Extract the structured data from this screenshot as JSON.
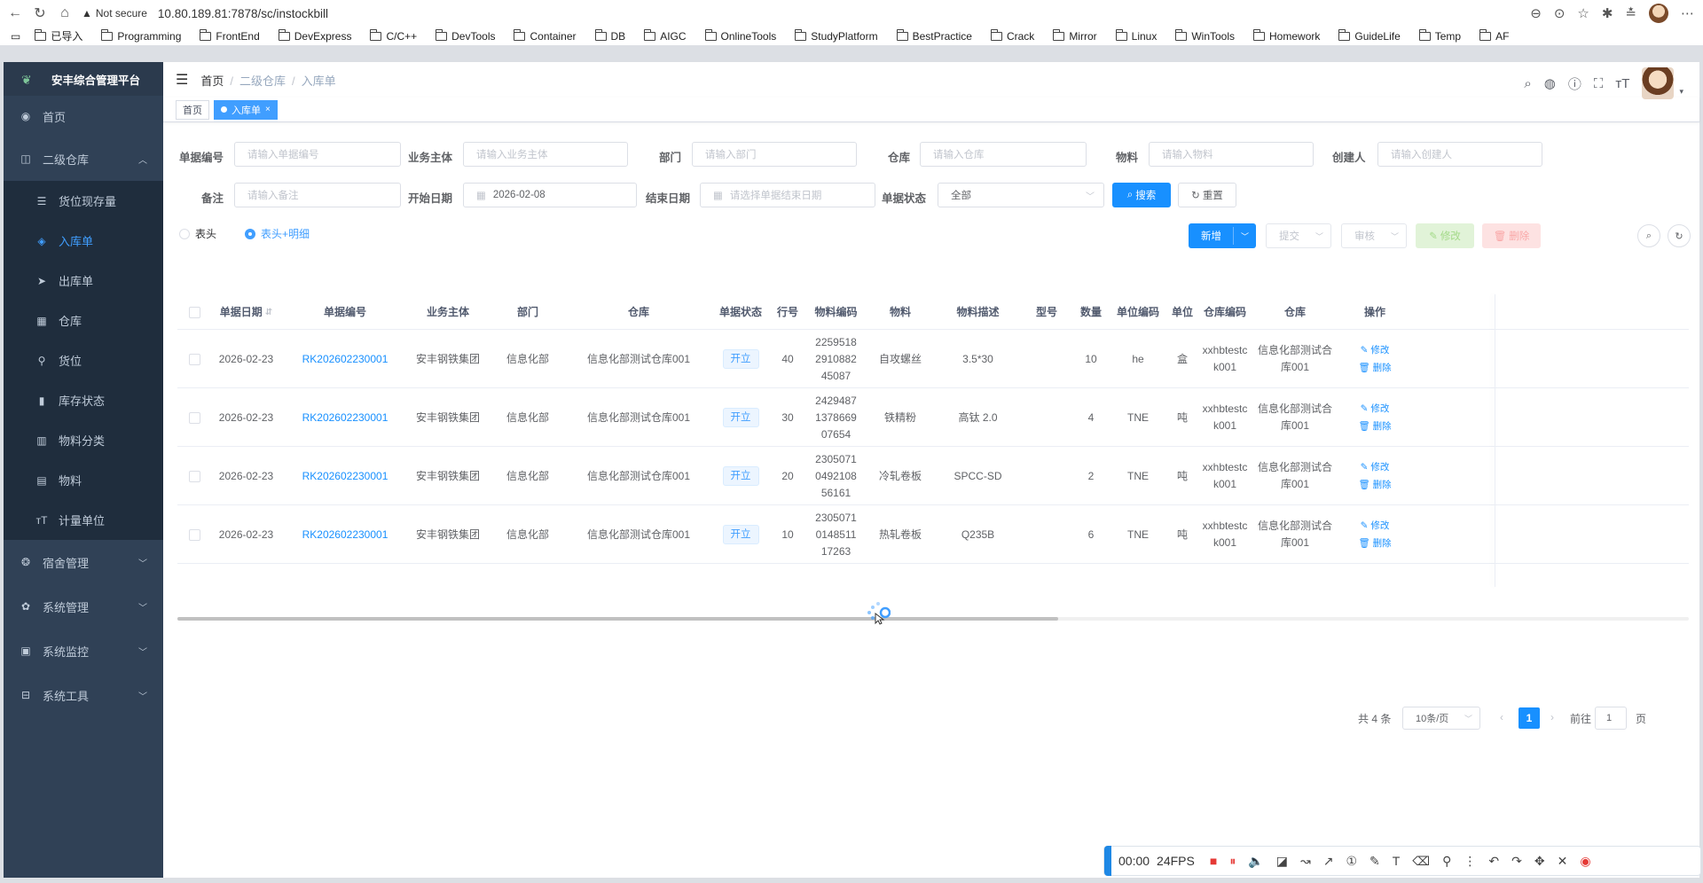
{
  "browser": {
    "security": "Not secure",
    "url": "10.80.189.81:7878/sc/instockbill",
    "bookmarks": [
      "已导入",
      "Programming",
      "FrontEnd",
      "DevExpress",
      "C/C++",
      "DevTools",
      "Container",
      "DB",
      "AIGC",
      "OnlineTools",
      "StudyPlatform",
      "BestPractice",
      "Crack",
      "Mirror",
      "Linux",
      "WinTools",
      "Homework",
      "GuideLife",
      "Temp",
      "AF"
    ]
  },
  "app": {
    "title": "安丰综合管理平台"
  },
  "sidebar": {
    "home": "首页",
    "warehouse2": "二级仓库",
    "sub": [
      "货位现存量",
      "入库单",
      "出库单",
      "仓库",
      "货位",
      "库存状态",
      "物料分类",
      "物料",
      "计量单位"
    ],
    "dorm": "宿舍管理",
    "system": "系统管理",
    "monitor": "系统监控",
    "tools": "系统工具"
  },
  "breadcrumb": {
    "home": "首页",
    "level2": "二级仓库",
    "current": "入库单"
  },
  "tags": {
    "home": "首页",
    "active": "入库单"
  },
  "filters": {
    "bill_no": {
      "label": "单据编号",
      "placeholder": "请输入单据编号"
    },
    "subject": {
      "label": "业务主体",
      "placeholder": "请输入业务主体"
    },
    "dept": {
      "label": "部门",
      "placeholder": "请输入部门"
    },
    "warehouse": {
      "label": "仓库",
      "placeholder": "请输入仓库"
    },
    "material": {
      "label": "物料",
      "placeholder": "请输入物料"
    },
    "creator": {
      "label": "创建人",
      "placeholder": "请输入创建人"
    },
    "remark": {
      "label": "备注",
      "placeholder": "请输入备注"
    },
    "start": {
      "label": "开始日期",
      "value": "2026-02-08"
    },
    "end": {
      "label": "结束日期",
      "placeholder": "请选择单据结束日期"
    },
    "status": {
      "label": "单据状态",
      "value": "全部"
    },
    "search": "搜索",
    "reset": "重置"
  },
  "view": {
    "header_only": "表头",
    "header_detail": "表头+明细"
  },
  "actions": {
    "add": "新增",
    "submit": "提交",
    "audit": "审核",
    "edit": "修改",
    "delete": "删除"
  },
  "table": {
    "headers": [
      "单据日期",
      "单据编号",
      "业务主体",
      "部门",
      "仓库",
      "单据状态",
      "行号",
      "物料编码",
      "物料",
      "物料描述",
      "型号",
      "数量",
      "单位编码",
      "单位",
      "仓库编码",
      "仓库",
      "操作"
    ],
    "rows": [
      {
        "date": "2026-02-23",
        "no": "RK202602230001",
        "subject": "安丰钢铁集团",
        "dept": "信息化部",
        "wh": "信息化部测试仓库001",
        "status": "开立",
        "line": "40",
        "code": "2259518\n2910882\n45087",
        "mat": "自攻螺丝",
        "desc": "3.5*30",
        "model": "",
        "qty": "10",
        "ucode": "he",
        "unit": "盒",
        "whcode": "xxhbtestc\nk001",
        "wh2": "信息化部测试合\n库001"
      },
      {
        "date": "2026-02-23",
        "no": "RK202602230001",
        "subject": "安丰钢铁集团",
        "dept": "信息化部",
        "wh": "信息化部测试仓库001",
        "status": "开立",
        "line": "30",
        "code": "2429487\n1378669\n07654",
        "mat": "铁精粉",
        "desc": "高钛 2.0",
        "model": "",
        "qty": "4",
        "ucode": "TNE",
        "unit": "吨",
        "whcode": "xxhbtestc\nk001",
        "wh2": "信息化部测试合\n库001"
      },
      {
        "date": "2026-02-23",
        "no": "RK202602230001",
        "subject": "安丰钢铁集团",
        "dept": "信息化部",
        "wh": "信息化部测试仓库001",
        "status": "开立",
        "line": "20",
        "code": "2305071\n0492108\n56161",
        "mat": "冷轧卷板",
        "desc": "SPCC-SD",
        "model": "",
        "qty": "2",
        "ucode": "TNE",
        "unit": "吨",
        "whcode": "xxhbtestc\nk001",
        "wh2": "信息化部测试合\n库001"
      },
      {
        "date": "2026-02-23",
        "no": "RK202602230001",
        "subject": "安丰钢铁集团",
        "dept": "信息化部",
        "wh": "信息化部测试仓库001",
        "status": "开立",
        "line": "10",
        "code": "2305071\n0148511\n17263",
        "mat": "热轧卷板",
        "desc": "Q235B",
        "model": "",
        "qty": "6",
        "ucode": "TNE",
        "unit": "吨",
        "whcode": "xxhbtestc\nk001",
        "wh2": "信息化部测试合\n库001"
      }
    ],
    "op_edit": "修改",
    "op_delete": "删除"
  },
  "pagination": {
    "total": "共 4 条",
    "size": "10条/页",
    "current": "1",
    "goto": "前往",
    "goto_value": "1",
    "page_unit": "页"
  },
  "recorder": {
    "time": "00:00",
    "fps": "24FPS"
  }
}
